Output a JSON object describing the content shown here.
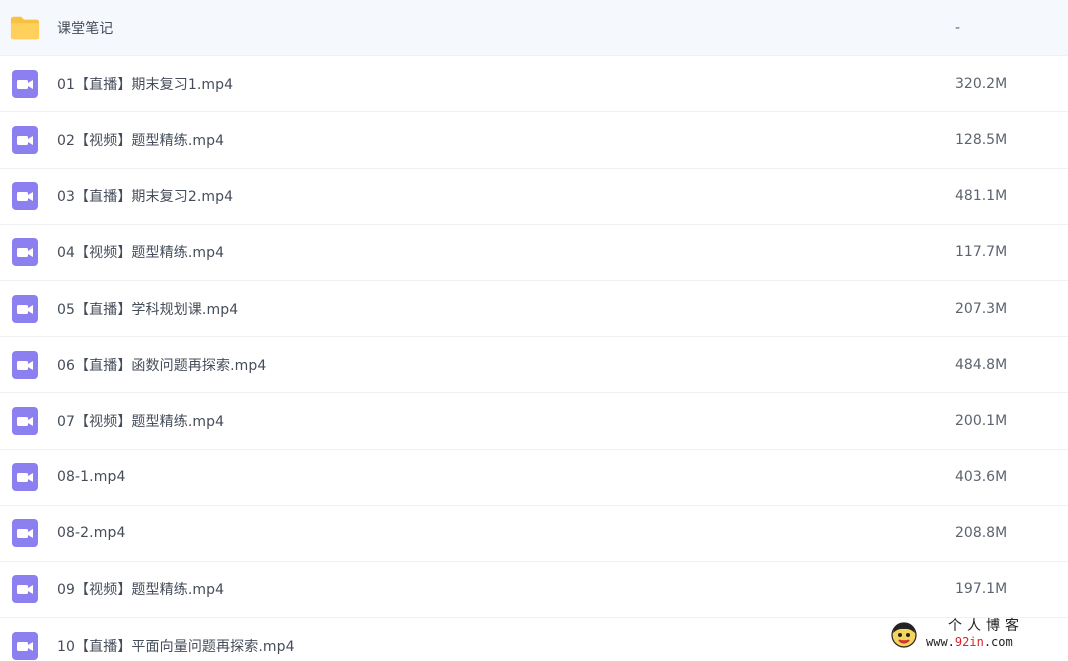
{
  "files": [
    {
      "type": "folder",
      "icon": "folder-icon",
      "name": "课堂笔记",
      "size": "-"
    },
    {
      "type": "video",
      "icon": "video-file-icon",
      "name": "01【直播】期末复习1.mp4",
      "size": "320.2M"
    },
    {
      "type": "video",
      "icon": "video-file-icon",
      "name": "02【视频】题型精练.mp4",
      "size": "128.5M"
    },
    {
      "type": "video",
      "icon": "video-file-icon",
      "name": "03【直播】期末复习2.mp4",
      "size": "481.1M"
    },
    {
      "type": "video",
      "icon": "video-file-icon",
      "name": "04【视频】题型精练.mp4",
      "size": "117.7M"
    },
    {
      "type": "video",
      "icon": "video-file-icon",
      "name": "05【直播】学科规划课.mp4",
      "size": "207.3M"
    },
    {
      "type": "video",
      "icon": "video-file-icon",
      "name": "06【直播】函数问题再探索.mp4",
      "size": "484.8M"
    },
    {
      "type": "video",
      "icon": "video-file-icon",
      "name": "07【视频】题型精练.mp4",
      "size": "200.1M"
    },
    {
      "type": "video",
      "icon": "video-file-icon",
      "name": "08-1.mp4",
      "size": "403.6M"
    },
    {
      "type": "video",
      "icon": "video-file-icon",
      "name": "08-2.mp4",
      "size": "208.8M"
    },
    {
      "type": "video",
      "icon": "video-file-icon",
      "name": "09【视频】题型精练.mp4",
      "size": "197.1M"
    },
    {
      "type": "video",
      "icon": "video-file-icon",
      "name": "10【直播】平面向量问题再探索.mp4",
      "size": ""
    }
  ],
  "watermark": {
    "title": "个人博客",
    "url_prefix": "www.",
    "url_highlight": "92in",
    "url_suffix": ".com"
  },
  "colors": {
    "folder": "#ffd15c",
    "folder_tab": "#f7c244",
    "video_icon": "#8c7ff0"
  }
}
